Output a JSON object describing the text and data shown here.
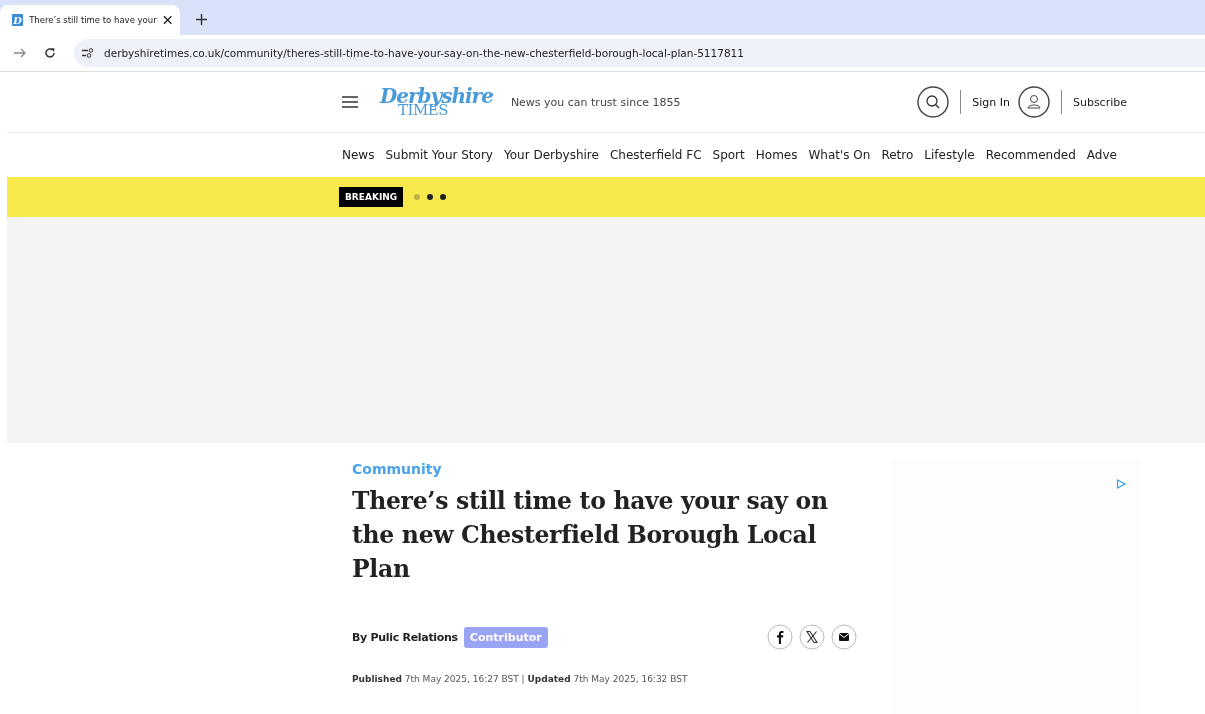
{
  "browser": {
    "tab": {
      "favicon": "D",
      "title": "There’s still time to have your"
    },
    "url": "derbyshiretimes.co.uk/community/theres-still-time-to-have-your-say-on-the-new-chesterfield-borough-local-plan-5117811"
  },
  "header": {
    "logo": [
      "Derbyshire",
      "TIMES"
    ],
    "tagline": "News you can trust since 1855",
    "sign_in": "Sign In",
    "subscribe": "Subscribe"
  },
  "nav": [
    "News",
    "Submit Your Story",
    "Your Derbyshire",
    "Chesterfield FC",
    "Sport",
    "Homes",
    "What's On",
    "Retro",
    "Lifestyle",
    "Recommended",
    "Adve"
  ],
  "breaking": {
    "label": "BREAKING"
  },
  "article": {
    "section": "Community",
    "title": "There’s still time to have your say on the new Chesterfield Borough Local Plan",
    "byline": "By Pulic Relations",
    "role": "Contributor",
    "published_label": "Published",
    "published": "7th May 2025, 16:27 BST",
    "separator": "|",
    "updated_label": "Updated",
    "updated": "7th May 2025, 16:32 BST"
  }
}
